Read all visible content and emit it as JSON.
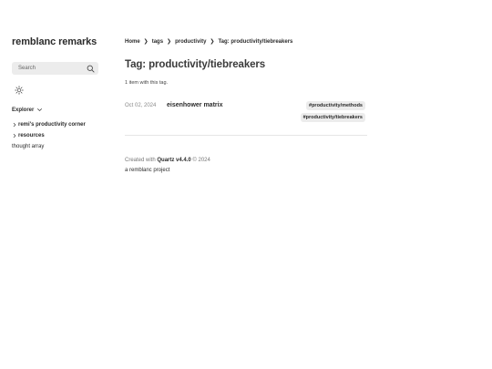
{
  "site": {
    "title": "remblanc remarks"
  },
  "search": {
    "placeholder": "Search"
  },
  "explorer": {
    "label": "Explorer",
    "items": [
      {
        "label": "remi's productivity corner",
        "type": "folder"
      },
      {
        "label": "resources",
        "type": "folder"
      },
      {
        "label": "thought array",
        "type": "page"
      }
    ]
  },
  "breadcrumb": {
    "items": [
      "Home",
      "tags",
      "productivity"
    ],
    "current": "Tag: productivity/tiebreakers"
  },
  "main": {
    "title": "Tag: productivity/tiebreakers",
    "count": "1 item with this tag."
  },
  "posts": [
    {
      "date": "Oct 02, 2024",
      "title": "eisenhower matrix",
      "tags": [
        "#productivity/methods",
        "#productivity/tiebreakers"
      ]
    }
  ],
  "footer": {
    "created_prefix": "Created with",
    "quartz_link": "Quartz v4.4.0",
    "copyright": "© 2024",
    "project_link": "a remblanc project"
  },
  "icons": {
    "search": "search-icon",
    "theme": "sun-icon",
    "explorer_toggle": "chevron-down-icon",
    "folder_chevron": "chevron-right-icon",
    "breadcrumb_separator": "chevron-right-icon"
  }
}
